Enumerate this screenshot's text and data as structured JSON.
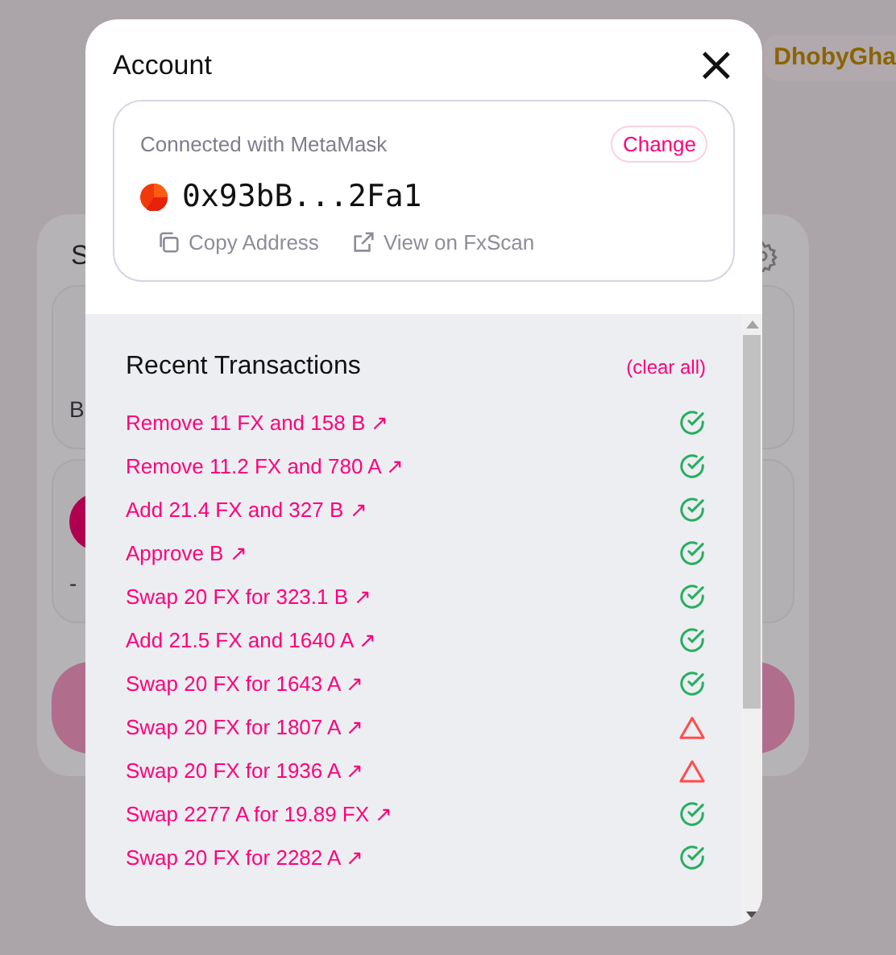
{
  "background": {
    "header_link": "DhobyGha",
    "card": {
      "title": "S",
      "label": "B",
      "value": "-"
    }
  },
  "modal": {
    "title": "Account",
    "close": "×",
    "wallet": {
      "connected_text": "Connected with MetaMask",
      "change_button": "Change",
      "address": "0x93bB...2Fa1",
      "copy_link": "Copy Address",
      "explorer_link": "View on FxScan"
    },
    "transactions": {
      "title": "Recent Transactions",
      "clear_link": "(clear all)",
      "items": [
        {
          "label": "Remove 11 FX and 158 B ↗",
          "kind": "success"
        },
        {
          "label": "Remove 11.2 FX and 780 A ↗",
          "kind": "success"
        },
        {
          "label": "Add 21.4 FX and 327 B ↗",
          "kind": "success"
        },
        {
          "label": "Approve B ↗",
          "kind": "success"
        },
        {
          "label": "Swap 20 FX for 323.1 B ↗",
          "kind": "success"
        },
        {
          "label": "Add 21.5 FX and 1640 A ↗",
          "kind": "success"
        },
        {
          "label": "Swap 20 FX for 1643 A ↗",
          "kind": "success"
        },
        {
          "label": "Swap 20 FX for 1807 A ↗",
          "kind": "failed"
        },
        {
          "label": "Swap 20 FX for 1936 A ↗",
          "kind": "failed"
        },
        {
          "label": "Swap 2277 A for 19.89 FX ↗",
          "kind": "success"
        },
        {
          "label": "Swap 20 FX for 2282 A ↗",
          "kind": "success"
        }
      ]
    }
  }
}
